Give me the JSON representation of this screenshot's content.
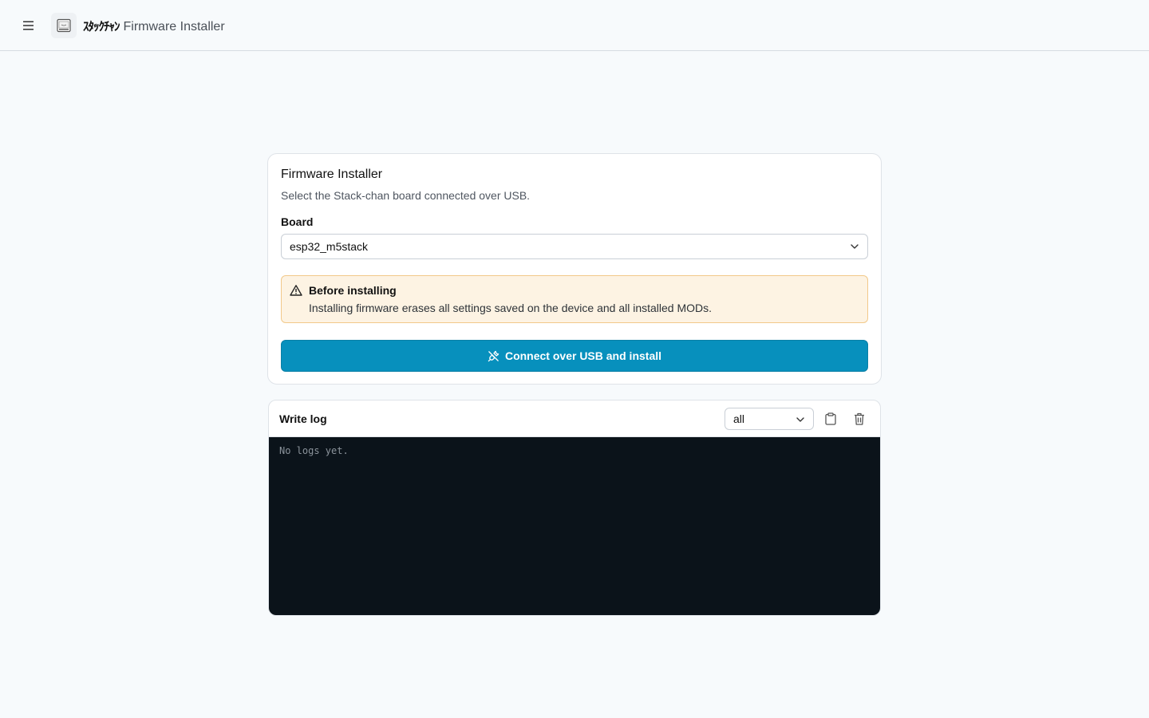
{
  "header": {
    "brand_jp": "ｽﾀｯｸﾁｬﾝ",
    "brand_title": "Firmware Installer",
    "menu_icon": "hamburger-icon",
    "logo_icon": "stackchan-logo-icon"
  },
  "installer": {
    "title": "Firmware Installer",
    "subtitle": "Select the Stack-chan board connected over USB.",
    "board_label": "Board",
    "board_selected": "esp32_m5stack",
    "warning": {
      "title": "Before installing",
      "body": "Installing firmware erases all settings saved on the device and all installed MODs.",
      "icon": "alert-triangle-icon"
    },
    "install_button": "Connect over USB and install",
    "install_icon": "usb-plug-icon"
  },
  "log": {
    "title": "Write log",
    "filter_selected": "all",
    "copy_icon": "clipboard-icon",
    "clear_icon": "trash-icon",
    "empty_text": "No logs yet."
  },
  "colors": {
    "accent": "#0790bd",
    "warning_bg": "#fdf3e3",
    "warning_border": "#f2c98a",
    "log_bg": "#0b131a"
  }
}
